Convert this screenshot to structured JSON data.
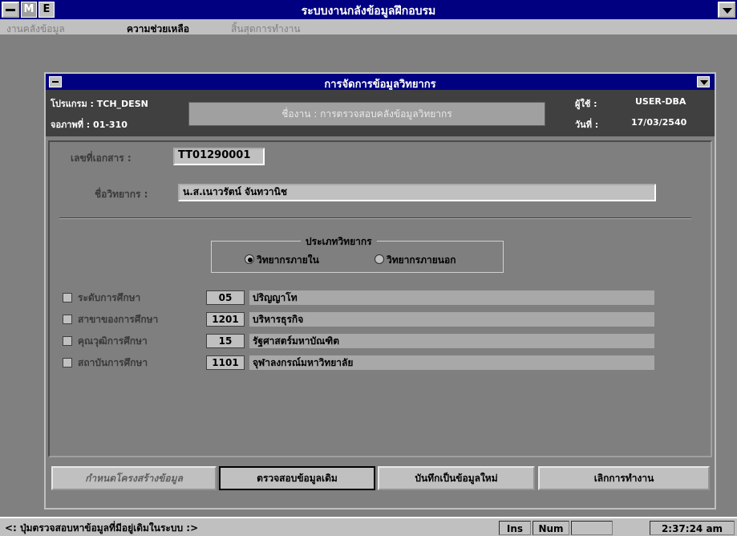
{
  "app": {
    "title": "ระบบงานกลังข้อมูลฝึกอบรม"
  },
  "menu": {
    "items": [
      {
        "label": "งานคลังข้อมูล",
        "state": "disabled"
      },
      {
        "label": "ความช่วยเหลือ",
        "state": "active"
      },
      {
        "label": "สิ้นสุดการทำงาน",
        "state": "disabled"
      }
    ]
  },
  "dialog": {
    "title": "การจัดการข้อมูลวิทยากร",
    "header": {
      "program": "โปรแกรม : TCH_DESN",
      "screen": "จอภาพที่ : 01-310",
      "doc_title": "ชื่องาน : การตรวจสอบคลังข้อมูลวิทยากร",
      "user_label": "ผู้ใช้ :",
      "user_value": "USER-DBA",
      "date_label": "วันที่ :",
      "date_value": "17/03/2540"
    },
    "doc_no": {
      "label": "เลขที่เอกสาร :",
      "value": "TT01290001"
    },
    "lecturer": {
      "label": "ชื่อวิทยากร :",
      "value": "น.ส.เนาวรัตน์ จันทวานิช"
    },
    "lecturer_type": {
      "legend": "ประเภทวิทยากร",
      "options": [
        {
          "label": "วิทยากรภายใน",
          "selected": true
        },
        {
          "label": "วิทยากรภายนอก",
          "selected": false
        }
      ]
    },
    "education_rows": [
      {
        "label": "ระดับการศึกษา",
        "code": "05",
        "desc": "ปริญญาโท",
        "checked": false
      },
      {
        "label": "สาขาของการศึกษา",
        "code": "1201",
        "desc": "บริหารธุรกิจ",
        "checked": false
      },
      {
        "label": "คุณวุฒิการศึกษา",
        "code": "15",
        "desc": "รัฐศาสตร์มหาบัณฑิต",
        "checked": false
      },
      {
        "label": "สถาบันการศึกษา",
        "code": "1101",
        "desc": "จุฬาลงกรณ์มหาวิทยาลัย",
        "checked": false
      }
    ],
    "buttons": {
      "define_structure": "กำหนดโครงสร้างข้อมูล",
      "check_existing": "ตรวจสอบข้อมูลเดิม",
      "save_new": "บันทึกเป็นข้อมูลใหม่",
      "cancel": "เลิกการทำงาน"
    }
  },
  "statusbar": {
    "message": "<: ปุ่มตรวจสอบหาข้อมูลที่มีอยู่เดิมในระบบ :>",
    "ins": "Ins",
    "num": "Num",
    "time": "2:37:24 am"
  }
}
